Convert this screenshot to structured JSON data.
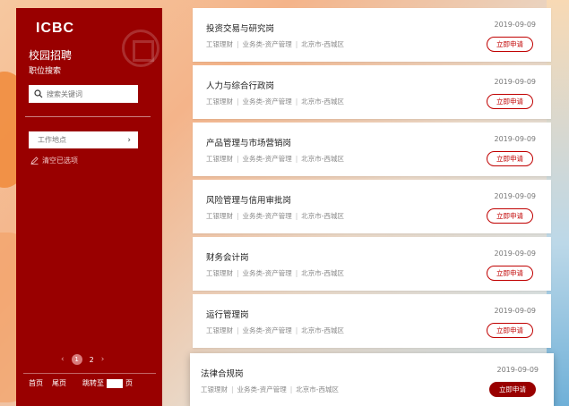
{
  "brand": {
    "logo": "ICBC",
    "site_title": "校园招聘",
    "site_subtitle": "职位搜索"
  },
  "search": {
    "placeholder": "搜索关键词"
  },
  "filter": {
    "location_label": "工作地点",
    "clear_label": "清空已选项"
  },
  "pagination": {
    "prev": "‹",
    "pages": [
      "1",
      "2"
    ],
    "active_page": "1",
    "next": "›"
  },
  "footer": {
    "first": "首页",
    "last": "尾页",
    "jump_label": "跳转至",
    "page_suffix": "页"
  },
  "jobs": [
    {
      "title": "投资交易与研究岗",
      "date": "2019-09-09",
      "company": "工银理财",
      "category": "业务类-资产管理",
      "location": "北京市-西城区",
      "apply": "立即申请"
    },
    {
      "title": "人力与综合行政岗",
      "date": "2019-09-09",
      "company": "工银理财",
      "category": "业务类-资产管理",
      "location": "北京市-西城区",
      "apply": "立即申请"
    },
    {
      "title": "产品管理与市场营销岗",
      "date": "2019-09-09",
      "company": "工银理财",
      "category": "业务类-资产管理",
      "location": "北京市-西城区",
      "apply": "立即申请"
    },
    {
      "title": "风险管理与信用审批岗",
      "date": "2019-09-09",
      "company": "工银理财",
      "category": "业务类-资产管理",
      "location": "北京市-西城区",
      "apply": "立即申请"
    },
    {
      "title": "财务会计岗",
      "date": "2019-09-09",
      "company": "工银理财",
      "category": "业务类-资产管理",
      "location": "北京市-西城区",
      "apply": "立即申请"
    },
    {
      "title": "运行管理岗",
      "date": "2019-09-09",
      "company": "工银理财",
      "category": "业务类-资产管理",
      "location": "北京市-西城区",
      "apply": "立即申请"
    },
    {
      "title": "法律合规岗",
      "date": "2019-09-09",
      "company": "工银理财",
      "category": "业务类-资产管理",
      "location": "北京市-西城区",
      "apply": "立即申请"
    }
  ],
  "colors": {
    "brand_red": "#990000",
    "accent_red": "#c00000"
  },
  "icons": {
    "search": "search-icon",
    "pencil": "pencil-icon",
    "chevron": "chevron-right-icon"
  }
}
